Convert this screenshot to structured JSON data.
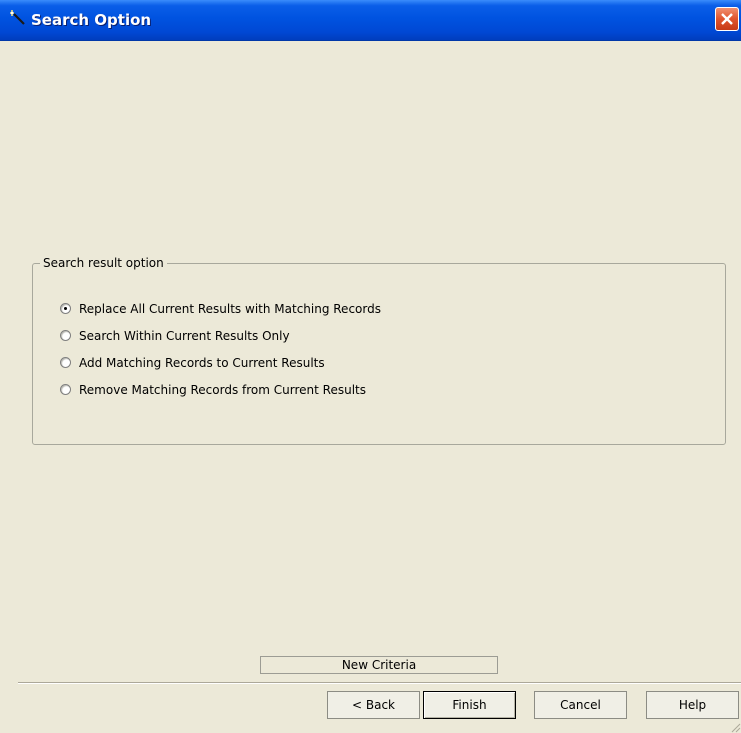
{
  "window": {
    "title": "Search Option",
    "title_icon": "wand-icon",
    "close_icon": "close-icon"
  },
  "groupbox": {
    "label": "Search result option",
    "options": [
      {
        "label": "Replace All Current Results with Matching Records",
        "selected": true
      },
      {
        "label": "Search Within Current Results Only",
        "selected": false
      },
      {
        "label": "Add Matching Records to Current Results",
        "selected": false
      },
      {
        "label": "Remove Matching Records from Current Results",
        "selected": false
      }
    ]
  },
  "status": {
    "text": "New Criteria"
  },
  "buttons": {
    "back": "< Back",
    "finish": "Finish",
    "cancel": "Cancel",
    "help": "Help"
  },
  "colors": {
    "titlebar": "#0053e0",
    "dialog_background": "#ece9d8",
    "close_button": "#e0542d"
  }
}
